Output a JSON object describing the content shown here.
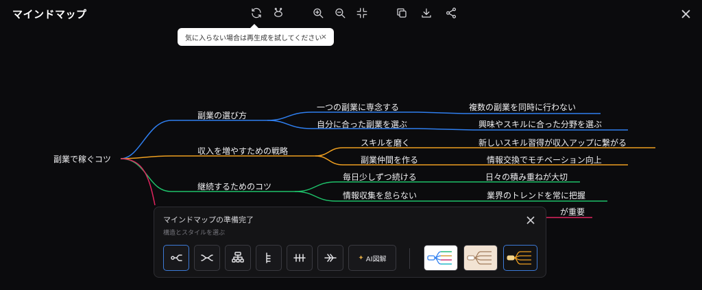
{
  "header": {
    "title": "マインドマップ",
    "tooltip": "気に入らない場合は再生成を試してください",
    "tooltip_close": "×",
    "toolbar_icons": [
      "refresh-icon",
      "lasso-icon",
      "zoom-in-icon",
      "zoom-out-icon",
      "fit-icon",
      "copy-icon",
      "download-icon",
      "share-icon"
    ],
    "close_icon": "close-icon"
  },
  "mindmap": {
    "root": "副業で稼ぐコツ",
    "branches": [
      {
        "label": "副業の選び方",
        "color": "#2f7ff0",
        "children": [
          {
            "label": "一つの副業に専念する",
            "leaf": "複数の副業を同時に行わない"
          },
          {
            "label": "自分に合った副業を選ぶ",
            "leaf": "興味やスキルに合った分野を選ぶ"
          }
        ]
      },
      {
        "label": "収入を増やすための戦略",
        "color": "#f0a020",
        "children": [
          {
            "label": "スキルを磨く",
            "leaf": "新しいスキル習得が収入アップに繋がる"
          },
          {
            "label": "副業仲間を作る",
            "leaf": "情報交換でモチベーション向上"
          }
        ]
      },
      {
        "label": "継続するためのコツ",
        "color": "#1ec26a",
        "children": [
          {
            "label": "毎日少しずつ続ける",
            "leaf": "日々の積み重ねが大切"
          },
          {
            "label": "情報収集を怠らない",
            "leaf": "業界のトレンドを常に把握"
          }
        ]
      }
    ],
    "hidden_branch_color": "#e0245e",
    "hidden_leaf_fragment": "が重要"
  },
  "panel": {
    "title": "マインドマップの準備完了",
    "subtitle": "構造とスタイルを選ぶ",
    "ai_label": "AI図解",
    "layout_icons": [
      "layout-right-icon",
      "layout-both-icon",
      "layout-org-icon",
      "layout-list-icon",
      "layout-timeline-icon",
      "layout-fishbone-icon"
    ],
    "style_options": [
      "white-style",
      "beige-style",
      "dark-style"
    ],
    "selected_style": "dark-style",
    "selected_layout": "layout-right-icon"
  }
}
